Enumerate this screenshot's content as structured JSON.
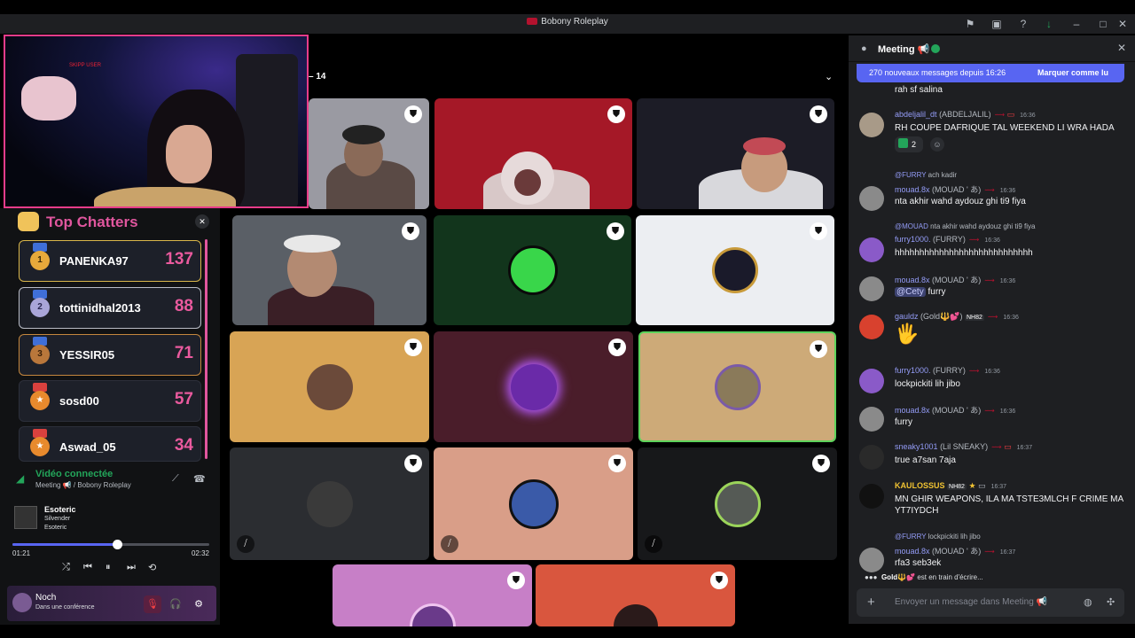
{
  "window": {
    "title": "Bobony Roleplay"
  },
  "stage": {
    "participant_count": "14"
  },
  "top_chatters": {
    "title": "Top Chatters",
    "entries": [
      {
        "rank": "1",
        "name": "PANENKA97",
        "score": "137"
      },
      {
        "rank": "2",
        "name": "tottinidhal2013",
        "score": "88"
      },
      {
        "rank": "3",
        "name": "YESSIR05",
        "score": "71"
      },
      {
        "rank": "",
        "name": "sosd00",
        "score": "57"
      },
      {
        "rank": "",
        "name": "Aswad_05",
        "score": "34"
      }
    ]
  },
  "voice": {
    "status": "Vidéo connectée",
    "channel": "Meeting 📢 / Bobony Roleplay"
  },
  "player": {
    "song": "Esoteric",
    "artist": "Silvender",
    "album": "Esoteric",
    "elapsed": "01:21",
    "duration": "02:32",
    "progress": 0.53
  },
  "user": {
    "name": "Noch",
    "status": "Dans une conférence"
  },
  "chat": {
    "channel": "Meeting",
    "new_messages": "270 nouveaux messages depuis 16:26",
    "mark_read": "Marquer comme lu",
    "messages": [
      {
        "text": "rah sf salina"
      },
      {
        "user": "abdeljalil_dt",
        "display": "(ABDELJALIL)",
        "time": "16:36",
        "text": "RH COUPE DAFRIQUE TAL WEEKEND LI WRA HADA",
        "reaction_count": "2"
      },
      {
        "reply_user": "@FURRY",
        "reply_text": "ach kadir",
        "user": "mouad.8x",
        "display": "(MOUAD ' あ)",
        "time": "16:36",
        "text": "nta akhir wahd aydouz ghi ti9 fiya"
      },
      {
        "reply_user": "@MOUAD",
        "reply_text": "nta akhir wahd aydouz ghi ti9 fiya",
        "user": "furry1000.",
        "display": "(FURRY)",
        "time": "16:36",
        "text": "hhhhhhhhhhhhhhhhhhhhhhhhhhhh"
      },
      {
        "user": "mouad.8x",
        "display": "(MOUAD ' あ)",
        "time": "16:36",
        "mention": "@Cety",
        "text": "furry"
      },
      {
        "user": "gauldz",
        "display": "(Gold🔱💕)",
        "badge": "NH82",
        "time": "16:36",
        "text": "🖐"
      },
      {
        "user": "furry1000.",
        "display": "(FURRY)",
        "time": "16:36",
        "text": "lockpickiti lih jibo"
      },
      {
        "user": "mouad.8x",
        "display": "(MOUAD ' あ)",
        "time": "16:36",
        "text": "furry"
      },
      {
        "user": "sneaky1001",
        "display": "(Lil SNEAKY)",
        "time": "16:37",
        "text": "true a7san 7aja"
      },
      {
        "user": "KAULOSSUS",
        "badge": "NH82",
        "time": "16:37",
        "text": "MN GHIR WEAPONS, ILA MA TSTE3MLCH F CRIME MA YT7IYDCH"
      },
      {
        "reply_user": "@FURRY",
        "reply_text": "lockpickiti lih jibo",
        "user": "mouad.8x",
        "display": "(MOUAD ' あ)",
        "time": "16:37",
        "text": "rfa3 seb3ek"
      }
    ],
    "typing": {
      "who": "Gold🔱💕",
      "text": "est en train d'écrire..."
    },
    "composer_placeholder": "Envoyer un message dans Meeting 📢"
  },
  "colors": {
    "accent": "#5865f2",
    "online": "#23a55a",
    "chatter_pink": "#e0569e",
    "webcam_border": "#e83c8a"
  }
}
